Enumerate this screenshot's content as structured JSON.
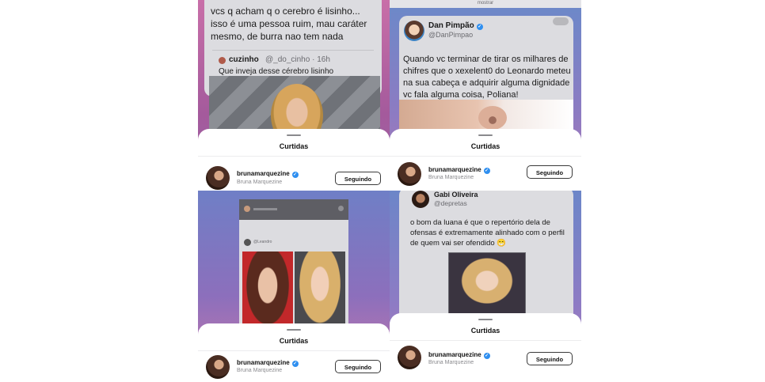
{
  "sheet": {
    "title": "Curtidas",
    "follower": {
      "username": "brunamarquezine",
      "full_name": "Bruna Marquezine",
      "follow_button": "Seguindo"
    }
  },
  "panel1": {
    "tweet_text": "vcs q acham q o cerebro é lisinho... isso é uma pessoa ruim, mau caráter mesmo, de burra nao tem nada",
    "quote_name": "cuzinho",
    "quote_handle": "@_do_cinho · 16h",
    "quote_text": "Que inveja desse cérebro lisinho"
  },
  "panel2": {
    "top_label": "mostrar",
    "name": "Dan Pimpão",
    "handle": "@DanPimpao",
    "tweet_text": "Quando vc terminar de tirar os milhares de chifres que o xexelent0 do Leonardo meteu na sua cabeça e adquirir alguma dignidade vc fala alguma coisa, Poliana!"
  },
  "panel3": {
    "inner_handle": "@Leandro"
  },
  "panel4": {
    "name": "Gabi Oliveira",
    "handle": "@depretas",
    "tweet_text": "o bom da luana é que o repertório dela de ofensas é extremamente alinhado com o perfil de quem vai ser ofendido 😁"
  }
}
